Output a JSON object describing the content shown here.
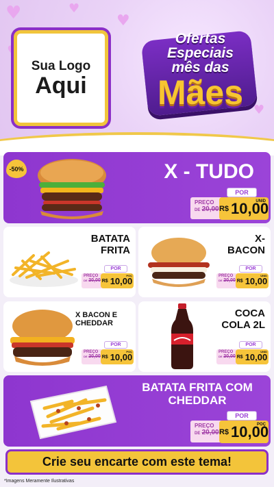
{
  "header": {
    "logo_line1": "Sua Logo",
    "logo_line2": "Aqui",
    "title_line1": "Ofertas",
    "title_line2": "Especiais",
    "title_line3": "mês das",
    "title_line4": "Mães"
  },
  "badge": "-50%",
  "products": [
    {
      "name": "X - TUDO",
      "por": "POR",
      "preco": "PREÇO",
      "de": "DE",
      "old": "20,00",
      "currency": "R$",
      "value": "10,00",
      "unit": "UNID",
      "image": "hamburger-icon"
    },
    {
      "name": "BATATA FRITA",
      "por": "POR",
      "preco": "PREÇO",
      "de": "DE",
      "old": "20,00",
      "currency": "R$",
      "value": "10,00",
      "unit": "POÇ",
      "image": "french-fries-icon"
    },
    {
      "name": "X- BACON",
      "por": "POR",
      "preco": "PREÇO",
      "de": "DE",
      "old": "20,00",
      "currency": "R$",
      "value": "10,00",
      "unit": "UNID",
      "image": "bacon-burger-icon"
    },
    {
      "name": "X BACON E CHEDDAR",
      "por": "POR",
      "preco": "PREÇO",
      "de": "DE",
      "old": "20,00",
      "currency": "R$",
      "value": "10,00",
      "unit": "POÇ",
      "image": "cheddar-burger-icon"
    },
    {
      "name": "COCA COLA 2L",
      "por": "POR",
      "preco": "PREÇO",
      "de": "DE",
      "old": "20,00",
      "currency": "R$",
      "value": "10,00",
      "unit": "UNID",
      "image": "soda-bottle-icon"
    },
    {
      "name": "BATATA FRITA COM CHEDDAR",
      "por": "POR",
      "preco": "PREÇO",
      "de": "DE",
      "old": "20,00",
      "currency": "R$",
      "value": "10,00",
      "unit": "POÇ",
      "image": "cheddar-fries-icon"
    }
  ],
  "cta": "Crie seu encarte com este tema!",
  "footnote": "*Imagens Meramente Ilustrativas",
  "colors": {
    "purple": "#8e36cf",
    "gold": "#f6c43a",
    "pink": "#f8d9ef"
  }
}
